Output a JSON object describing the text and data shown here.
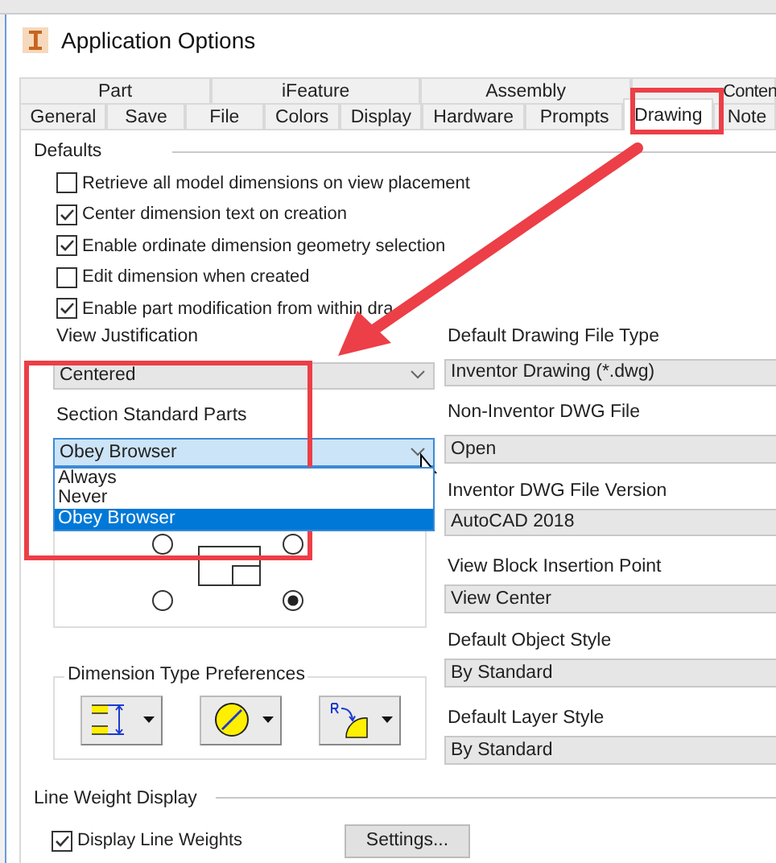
{
  "window": {
    "title": "Application Options"
  },
  "tabs_top": [
    {
      "label": "Part",
      "selected": false
    },
    {
      "label": "iFeature",
      "selected": false
    },
    {
      "label": "Assembly",
      "selected": false
    },
    {
      "label": "Conten",
      "selected": false
    }
  ],
  "tabs": [
    {
      "label": "General",
      "selected": false
    },
    {
      "label": "Save",
      "selected": false
    },
    {
      "label": "File",
      "selected": false
    },
    {
      "label": "Colors",
      "selected": false
    },
    {
      "label": "Display",
      "selected": false
    },
    {
      "label": "Hardware",
      "selected": false
    },
    {
      "label": "Prompts",
      "selected": false
    },
    {
      "label": "Drawing",
      "selected": true
    },
    {
      "label": "Note",
      "selected": false
    }
  ],
  "defaults": {
    "heading": "Defaults",
    "checkboxes": [
      {
        "label": "Retrieve all model dimensions on view placement",
        "checked": false
      },
      {
        "label": "Center dimension text on creation",
        "checked": true
      },
      {
        "label": "Enable ordinate dimension geometry selection",
        "checked": true
      },
      {
        "label": "Edit dimension when created",
        "checked": false
      },
      {
        "label": "Enable part modification from within dra",
        "checked": true
      }
    ]
  },
  "fields_left": [
    {
      "label": "View Justification",
      "value": "Centered",
      "expanded": false
    },
    {
      "label": "Section Standard Parts",
      "value": "Obey Browser",
      "expanded": true,
      "options": [
        {
          "label": "Always",
          "selected": false
        },
        {
          "label": "Never",
          "selected": false
        },
        {
          "label": "Obey Browser",
          "selected": true
        }
      ]
    }
  ],
  "view_position_radios": [
    {
      "selected": false
    },
    {
      "selected": false
    },
    {
      "selected": false
    },
    {
      "selected": true
    }
  ],
  "dimension_type_preferences": {
    "heading": "Dimension Type Preferences"
  },
  "fields_right": [
    {
      "label": "Default Drawing File Type",
      "value": "Inventor Drawing (*.dwg)"
    },
    {
      "label": "Non-Inventor DWG File",
      "value": "Open"
    },
    {
      "label": "Inventor DWG File Version",
      "value": "AutoCAD 2018"
    },
    {
      "label": "View Block Insertion Point",
      "value": "View Center"
    },
    {
      "label": "Default Object Style",
      "value": "By Standard"
    },
    {
      "label": "Default Layer Style",
      "value": "By Standard"
    }
  ],
  "line_weight_display": {
    "heading": "Line Weight Display",
    "checkbox": {
      "label": "Display Line Weights",
      "checked": true
    },
    "settings_button": "Settings..."
  }
}
